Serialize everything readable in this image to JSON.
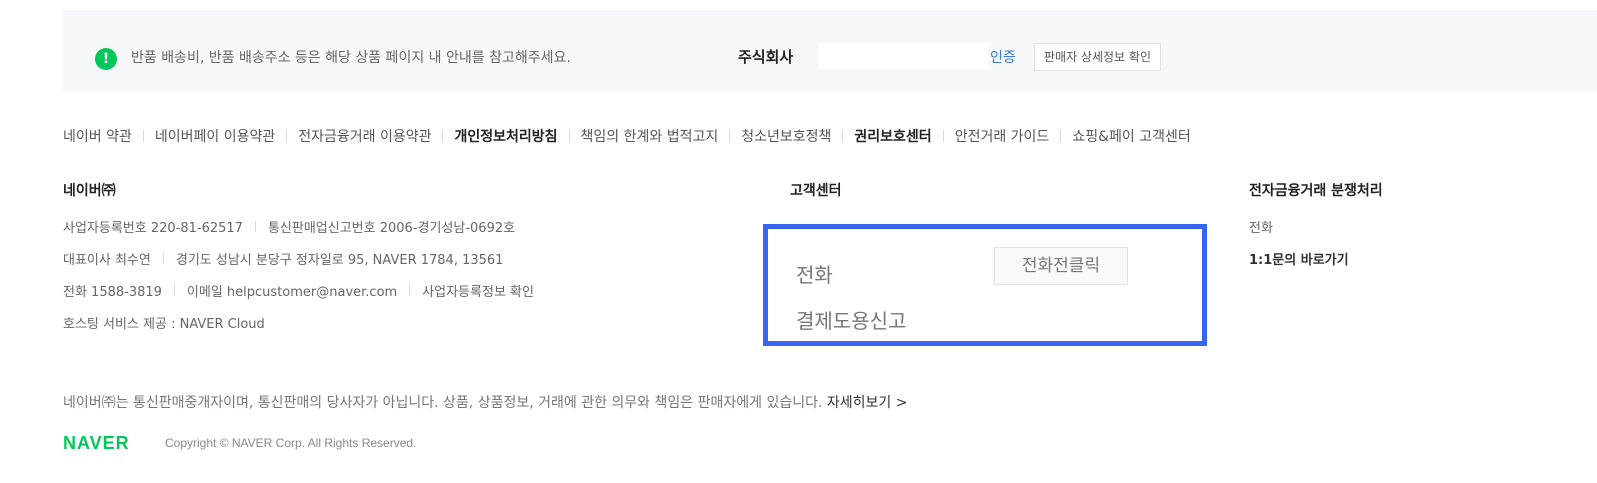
{
  "notice": {
    "icon": "exclamation-circle-icon",
    "message": "반품 배송비, 반품 배송주소 등은 해당 상품 페이지 내 안내를 참고해주세요.",
    "company": "주식회사",
    "auth_label": "인증",
    "detail_button": "판매자 상세정보 확인"
  },
  "links": [
    {
      "label": "네이버 약관",
      "bold": false
    },
    {
      "label": "네이버페이 이용약관",
      "bold": false
    },
    {
      "label": "전자금융거래 이용약관",
      "bold": false
    },
    {
      "label": "개인정보처리방침",
      "bold": true
    },
    {
      "label": "책임의 한계와 법적고지",
      "bold": false
    },
    {
      "label": "청소년보호정책",
      "bold": false
    },
    {
      "label": "권리보호센터",
      "bold": true
    },
    {
      "label": "안전거래 가이드",
      "bold": false
    },
    {
      "label": "쇼핑&페이 고객센터",
      "bold": false
    }
  ],
  "company_info": {
    "title": "네이버㈜",
    "business_reg": "사업자등록번호 220-81-62517",
    "ecommerce_reg": "통신판매업신고번호 2006-경기성남-0692호",
    "ceo": "대표이사 최수연",
    "address": "경기도 성남시 분당구 정자일로 95, NAVER 1784, 13561",
    "phone": "전화 1588-3819",
    "email": "이메일 helpcustomer@naver.com",
    "business_info_link": "사업자등록정보 확인",
    "hosting": "호스팅 서비스 제공 : NAVER Cloud"
  },
  "customer_center": {
    "title": "고객센터",
    "phone_label": "전화",
    "phone_button": "전화전클릭",
    "payment_report": "결제도용신고"
  },
  "dispute": {
    "title": "전자금융거래 분쟁처리",
    "phone": "전화",
    "inquiry_link": "1:1문의 바로가기"
  },
  "disclaimer": {
    "text": "네이버㈜는 통신판매중개자이며, 통신판매의 당사자가 아닙니다. 상품, 상품정보, 거래에 관한 의무와 책임은 판매자에게 있습니다.",
    "more": "자세히보기 >"
  },
  "footer": {
    "brand": "NAVER",
    "copyright": "Copyright © NAVER Corp. All Rights Reserved."
  },
  "colors": {
    "brand_green": "#03c75a",
    "highlight_blue": "#3466f2",
    "auth_blue": "#3a7bd5"
  }
}
